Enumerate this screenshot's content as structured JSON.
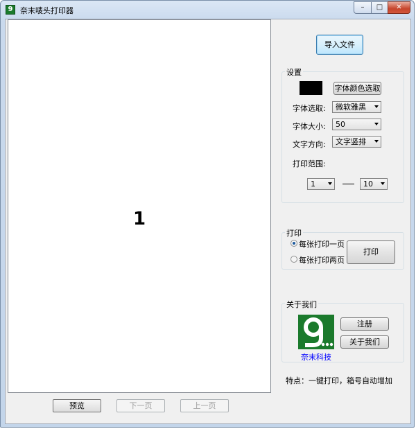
{
  "window": {
    "title": "奈末唛头打印器",
    "minimize_glyph": "–",
    "maximize_glyph": "□",
    "close_glyph": "✕"
  },
  "preview": {
    "page_number": "1"
  },
  "nav": {
    "preview_label": "预览",
    "next_label": "下一页",
    "prev_label": "上一页"
  },
  "import_label": "导入文件",
  "settings": {
    "title": "设置",
    "font_color": "#000000",
    "font_color_button": "字体颜色选取",
    "font_select_label": "字体选取:",
    "font_select_value": "微软雅黑",
    "font_size_label": "字体大小:",
    "font_size_value": "50",
    "text_direction_label": "文字方向:",
    "text_direction_value": "文字竖排",
    "print_range_label": "打印范围:",
    "range_from": "1",
    "range_to": "10"
  },
  "print": {
    "title": "打印",
    "option_one": "每张打印一页",
    "option_two": "每张打印两页",
    "selected": "option_one",
    "print_button": "打印"
  },
  "about": {
    "title": "关于我们",
    "register_button": "注册",
    "about_button": "关于我们",
    "logo_caption": "奈末科技"
  },
  "feature_text": "特点：一键打印，箱号自动增加"
}
